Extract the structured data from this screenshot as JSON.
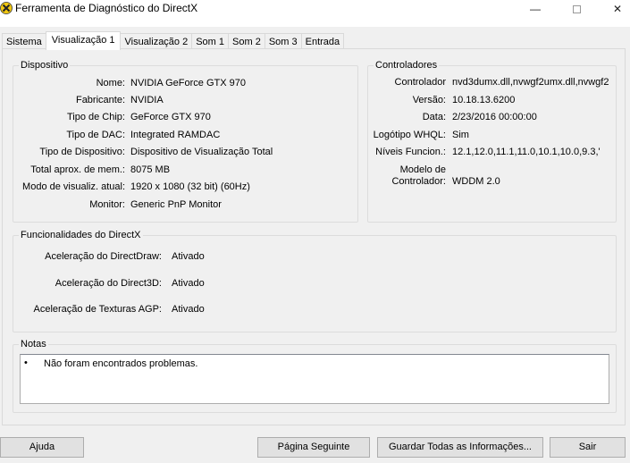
{
  "window": {
    "title": "Ferramenta de Diagnóstico do DirectX",
    "minimize_glyph": "—",
    "close_glyph": "✕"
  },
  "tabs": [
    {
      "label": "Sistema"
    },
    {
      "label": "Visualização 1",
      "active": true
    },
    {
      "label": "Visualização 2"
    },
    {
      "label": "Som 1"
    },
    {
      "label": "Som 2"
    },
    {
      "label": "Som 3"
    },
    {
      "label": "Entrada"
    }
  ],
  "device": {
    "title": "Dispositivo",
    "rows": [
      {
        "label": "Nome:",
        "value": "NVIDIA GeForce GTX 970"
      },
      {
        "label": "Fabricante:",
        "value": "NVIDIA"
      },
      {
        "label": "Tipo de Chip:",
        "value": "GeForce GTX 970"
      },
      {
        "label": "Tipo de DAC:",
        "value": "Integrated RAMDAC"
      },
      {
        "label": "Tipo de Dispositivo:",
        "value": "Dispositivo de Visualização Total"
      },
      {
        "label": "Total aprox. de mem.:",
        "value": "8075 MB"
      },
      {
        "label": "Modo de visualiz. atual:",
        "value": "1920 x 1080 (32 bit) (60Hz)"
      },
      {
        "label": "Monitor:",
        "value": "Generic PnP Monitor"
      }
    ]
  },
  "drivers": {
    "title": "Controladores",
    "rows": [
      {
        "label": "Controlador",
        "value": "nvd3dumx.dll,nvwgf2umx.dll,nvwgf2"
      },
      {
        "label": "Versão:",
        "value": "10.18.13.6200"
      },
      {
        "label": "Data:",
        "value": "2/23/2016 00:00:00"
      },
      {
        "label": "Logótipo WHQL:",
        "value": "Sim"
      },
      {
        "label": "Níveis Funcion.:",
        "value": "12.1,12.0,11.1,11.0,10.1,10.0,9.3,'"
      }
    ],
    "model_label_line1": "Modelo de",
    "model_label_line2": "Controlador:",
    "model_value": "WDDM 2.0"
  },
  "features": {
    "title": "Funcionalidades do DirectX",
    "rows": [
      {
        "label": "Aceleração do DirectDraw:",
        "value": "Ativado"
      },
      {
        "label": "Aceleração do Direct3D:",
        "value": "Ativado"
      },
      {
        "label": "Aceleração de Texturas AGP:",
        "value": "Ativado"
      }
    ]
  },
  "notes": {
    "title": "Notas",
    "bullet": "•",
    "text": "Não foram encontrados problemas."
  },
  "buttons": {
    "help": "Ajuda",
    "next_page": "Página Seguinte",
    "save_all": "Guardar Todas as Informações...",
    "exit": "Sair"
  }
}
